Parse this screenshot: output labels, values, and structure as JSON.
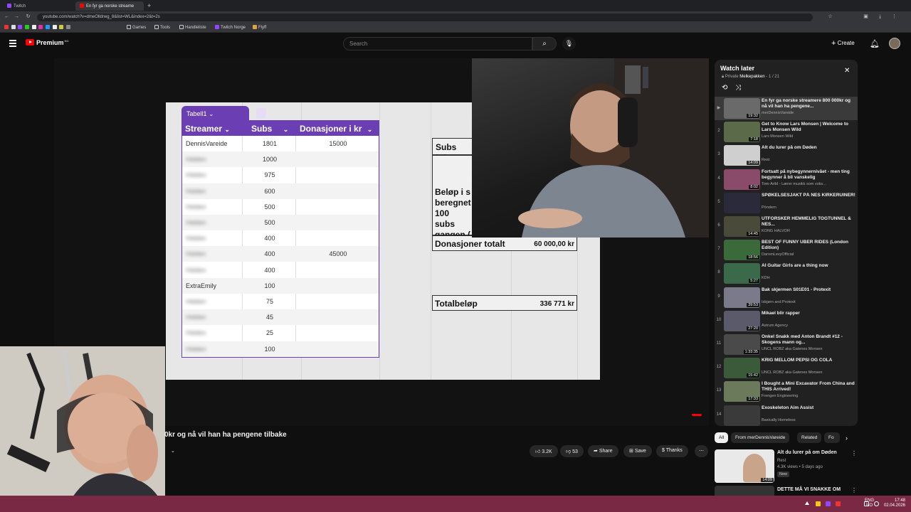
{
  "browser": {
    "tabs": [
      {
        "label": "Twitch",
        "color": "#9146ff"
      },
      {
        "label": "En fyr ga norske streame",
        "color": "#ff0000"
      }
    ],
    "new_tab": "+",
    "url": "youtube.com/watch?v=dmeOlldrwg_8&list=WL&index=2&t=2s",
    "bookmarks": [
      "Games",
      "Tools",
      "Handleliste",
      "Twitch Norge",
      "Flyff"
    ]
  },
  "header": {
    "logo": "Premium",
    "logo_sup": "NO",
    "search_placeholder": "Search",
    "create_label": "Create"
  },
  "sheet": {
    "table_tab": "Tabell1",
    "columns": [
      "Streamer",
      "Subs",
      "Donasjoner i kr"
    ],
    "rows": [
      {
        "name": "DennisVareide",
        "subs": "1801",
        "don": "15000",
        "blurred": false
      },
      {
        "name": "Hidden",
        "subs": "1000",
        "don": "",
        "blurred": true
      },
      {
        "name": "Hidden",
        "subs": "975",
        "don": "",
        "blurred": true
      },
      {
        "name": "Hidden",
        "subs": "600",
        "don": "",
        "blurred": true
      },
      {
        "name": "Hidden",
        "subs": "500",
        "don": "",
        "blurred": true
      },
      {
        "name": "Hidden",
        "subs": "500",
        "don": "",
        "blurred": true
      },
      {
        "name": "Hidden",
        "subs": "400",
        "don": "",
        "blurred": true
      },
      {
        "name": "Hidden",
        "subs": "400",
        "don": "45000",
        "blurred": true
      },
      {
        "name": "Hidden",
        "subs": "400",
        "don": "",
        "blurred": true
      },
      {
        "name": "ExtraEmily",
        "subs": "100",
        "don": "",
        "blurred": false
      },
      {
        "name": "Hidden",
        "subs": "75",
        "don": "",
        "blurred": true
      },
      {
        "name": "Hidden",
        "subs": "45",
        "don": "",
        "blurred": true
      },
      {
        "name": "Hidden",
        "subs": "25",
        "don": "",
        "blurred": true
      },
      {
        "name": "Hidden",
        "subs": "100",
        "don": "",
        "blurred": true
      }
    ],
    "subs_total_label": "Subs tota",
    "belop_label": "Beløp i s beregnet 100 subs gangen (",
    "donasjoner_label": "Donasjoner totalt",
    "donasjoner_value": "60 000,00 kr",
    "total_label": "Totalbeløp",
    "total_value": "336 771 kr"
  },
  "video": {
    "title": "0kr og nå vil han ha pengene tilbake",
    "likes": "3.2K",
    "dislikes": "53",
    "share": "Share",
    "save": "Save",
    "thanks": "Thanks"
  },
  "playlist": {
    "title": "Watch later",
    "privacy": "Private",
    "owner": "Melkepakken",
    "position": "1 / 21",
    "items": [
      {
        "idx": "▶",
        "title": "En fyr ga norske streamere 800 000kr og nå vil han ha pengene...",
        "channel": "merDennisVareide",
        "dur": "19:32",
        "color": "#6a6a6a"
      },
      {
        "idx": "2",
        "title": "Get to Know Lars Monsen | Welcome to Lars Monsen Wild",
        "channel": "Lars Monsen Wild",
        "dur": "7:18",
        "color": "#5b6b4a"
      },
      {
        "idx": "3",
        "title": "Alt du lurer på om Døden",
        "channel": "Rest",
        "dur": "14:09",
        "color": "#cfcfcf"
      },
      {
        "idx": "4",
        "title": "Fortsatt på nybegynnernivået - men ting begynner å bli vanskelig",
        "channel": "Tom-Arild - Lærer musikk som voks...",
        "dur": "8:02",
        "color": "#8a4a6a"
      },
      {
        "idx": "5",
        "title": "SPØKELSESJAKT PÅ NES KIRKERUINER!",
        "channel": "Pöndern",
        "dur": "",
        "color": "#2a2a3a"
      },
      {
        "idx": "6",
        "title": "UTFORSKER HEMMELIG TOGTUNNEL & NES...",
        "channel": "KONG HALVOR",
        "dur": "14:45",
        "color": "#4a4a3a"
      },
      {
        "idx": "7",
        "title": "BEST OF FUNNY UBER RIDES (London Edition)",
        "channel": "DarrenLevyOfficial",
        "dur": "18:56",
        "color": "#3a6a3a"
      },
      {
        "idx": "8",
        "title": "AI Guitar Girls are a thing now",
        "channel": "KDH",
        "dur": "5:27",
        "color": "#3a6a4a"
      },
      {
        "idx": "9",
        "title": "Bak skjermen S01E01 - Protexit",
        "channel": "Isbjørn and Protexit",
        "dur": "39:53",
        "color": "#7a7a8a"
      },
      {
        "idx": "10",
        "title": "Mikael blir rapper",
        "channel": "Astrum Agency",
        "dur": "27:20",
        "color": "#5a5a6a"
      },
      {
        "idx": "11",
        "title": "Onkel Snakk med Anton Brandt #12 - Skogens mann og...",
        "channel": "UNCL ROBZ aka Gatenes Monsen",
        "dur": "1:33:35",
        "color": "#4a4a4a"
      },
      {
        "idx": "12",
        "title": "KRIG MELLOM PEPSI OG COLA",
        "channel": "UNCL ROBZ aka Gatenes Monsen",
        "dur": "15:42",
        "color": "#3a5a3a"
      },
      {
        "idx": "13",
        "title": "I Bought a Mini Excavator From China and THIS Arrived!",
        "channel": "Frengen Engineering",
        "dur": "17:33",
        "color": "#6a7a5a"
      },
      {
        "idx": "14",
        "title": "Exoskeleton Aim Assist",
        "channel": "Basically Homeless",
        "dur": "",
        "color": "#3a3a3a"
      }
    ]
  },
  "chips": [
    "All",
    "From merDennisVareide",
    "Related",
    "Fo"
  ],
  "recommendation": {
    "title": "Alt du lurer på om Døden",
    "channel": "Rest",
    "meta": "4.3K views • 5 days ago",
    "badge": "New",
    "dur": "14:09",
    "next_title": "DETTE MÅ VI SNAKKE OM"
  },
  "taskbar": {
    "lang1": "ENG",
    "lang2": "NO",
    "time": "17:48",
    "date": "02.04.2026"
  }
}
